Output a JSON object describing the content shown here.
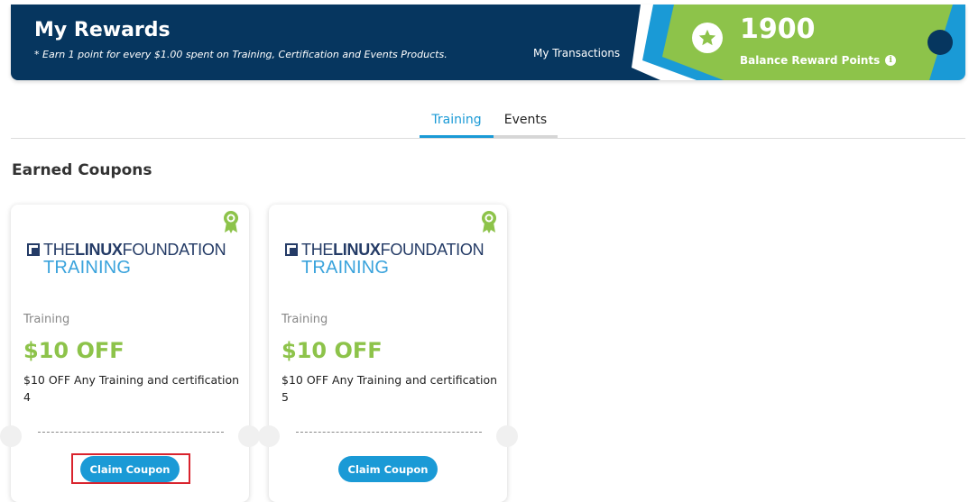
{
  "banner": {
    "title": "My Rewards",
    "subtitle": "* Earn 1 point for every $1.00 spent on Training, Certification and Events Products.",
    "transactions_link": "My Transactions",
    "points": "1900",
    "points_label": "Balance Reward Points",
    "info_icon": "info-icon",
    "star_icon": "star-icon"
  },
  "tabs": [
    {
      "label": "Training",
      "active": true
    },
    {
      "label": "Events",
      "active": false
    }
  ],
  "section_title": "Earned Coupons",
  "coupons": [
    {
      "logo_line1_a": "THE",
      "logo_line1_b": "LINUX",
      "logo_line1_c": "FOUNDATION",
      "logo_line2": "TRAINING",
      "category": "Training",
      "amount": "$10 OFF",
      "description": "$10 OFF Any Training and certification 4",
      "button": "Claim Coupon"
    },
    {
      "logo_line1_a": "THE",
      "logo_line1_b": "LINUX",
      "logo_line1_c": "FOUNDATION",
      "logo_line2": "TRAINING",
      "category": "Training",
      "amount": "$10 OFF",
      "description": "$10 OFF Any Training and certification 5",
      "button": "Claim Coupon"
    }
  ],
  "colors": {
    "banner_bg": "#06365f",
    "points_green": "#8dc34a",
    "accent_blue": "#1a9ad6",
    "highlight_red": "#d9232d"
  }
}
